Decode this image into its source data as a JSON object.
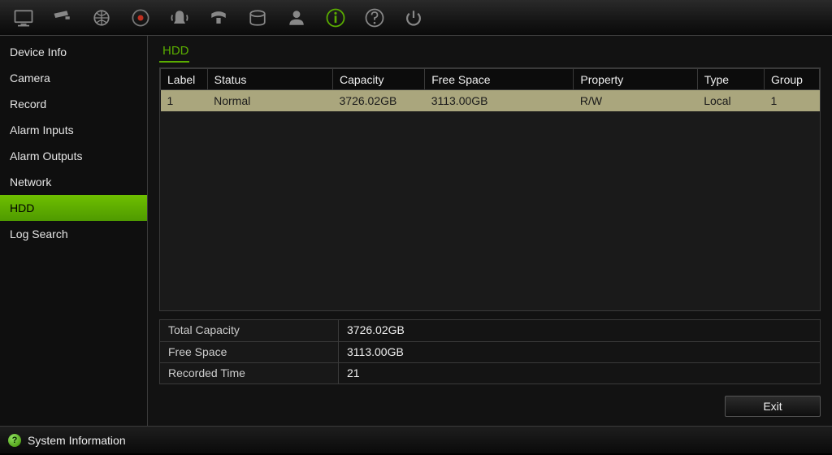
{
  "toolbar": {
    "icons": [
      "monitor-icon",
      "camera-icon",
      "globe-icon",
      "record-icon",
      "alarm-icon",
      "ptz-icon",
      "hdd-icon",
      "user-icon",
      "info-icon",
      "help-icon",
      "power-icon"
    ],
    "active_index": 8
  },
  "sidebar": {
    "items": [
      {
        "label": "Device Info"
      },
      {
        "label": "Camera"
      },
      {
        "label": "Record"
      },
      {
        "label": "Alarm Inputs"
      },
      {
        "label": "Alarm Outputs"
      },
      {
        "label": "Network"
      },
      {
        "label": "HDD"
      },
      {
        "label": "Log Search"
      }
    ],
    "active_index": 6
  },
  "page": {
    "title": "HDD"
  },
  "table": {
    "headers": {
      "label": "Label",
      "status": "Status",
      "capacity": "Capacity",
      "free_space": "Free Space",
      "property": "Property",
      "type": "Type",
      "group": "Group"
    },
    "rows": [
      {
        "label": "1",
        "status": "Normal",
        "capacity": "3726.02GB",
        "free_space": "3113.00GB",
        "property": "R/W",
        "type": "Local",
        "group": "1",
        "selected": true
      }
    ]
  },
  "summary": {
    "total_capacity_label": "Total Capacity",
    "total_capacity_value": "3726.02GB",
    "free_space_label": "Free Space",
    "free_space_value": "3113.00GB",
    "recorded_time_label": "Recorded Time",
    "recorded_time_value": "21"
  },
  "buttons": {
    "exit": "Exit"
  },
  "statusbar": {
    "text": "System Information"
  }
}
